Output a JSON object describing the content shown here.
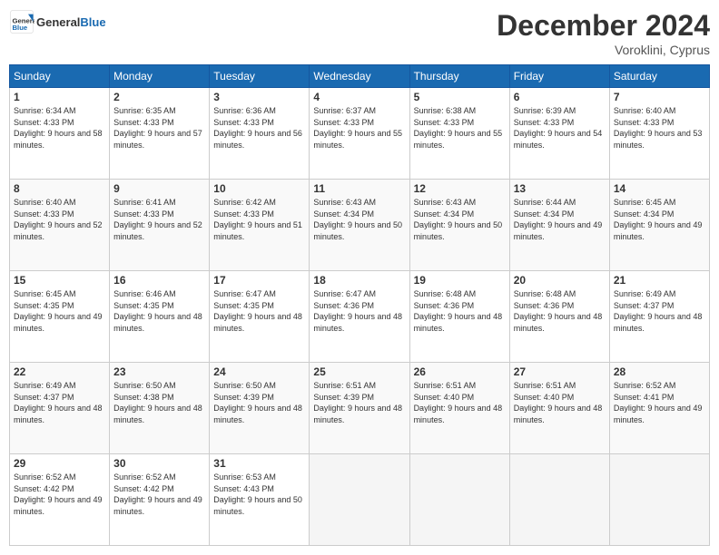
{
  "header": {
    "logo_general": "General",
    "logo_blue": "Blue",
    "month_title": "December 2024",
    "location": "Voroklini, Cyprus"
  },
  "weekdays": [
    "Sunday",
    "Monday",
    "Tuesday",
    "Wednesday",
    "Thursday",
    "Friday",
    "Saturday"
  ],
  "weeks": [
    [
      {
        "day": 1,
        "sunrise": "6:34 AM",
        "sunset": "4:33 PM",
        "daylight": "9 hours and 58 minutes."
      },
      {
        "day": 2,
        "sunrise": "6:35 AM",
        "sunset": "4:33 PM",
        "daylight": "9 hours and 57 minutes."
      },
      {
        "day": 3,
        "sunrise": "6:36 AM",
        "sunset": "4:33 PM",
        "daylight": "9 hours and 56 minutes."
      },
      {
        "day": 4,
        "sunrise": "6:37 AM",
        "sunset": "4:33 PM",
        "daylight": "9 hours and 55 minutes."
      },
      {
        "day": 5,
        "sunrise": "6:38 AM",
        "sunset": "4:33 PM",
        "daylight": "9 hours and 55 minutes."
      },
      {
        "day": 6,
        "sunrise": "6:39 AM",
        "sunset": "4:33 PM",
        "daylight": "9 hours and 54 minutes."
      },
      {
        "day": 7,
        "sunrise": "6:40 AM",
        "sunset": "4:33 PM",
        "daylight": "9 hours and 53 minutes."
      }
    ],
    [
      {
        "day": 8,
        "sunrise": "6:40 AM",
        "sunset": "4:33 PM",
        "daylight": "9 hours and 52 minutes."
      },
      {
        "day": 9,
        "sunrise": "6:41 AM",
        "sunset": "4:33 PM",
        "daylight": "9 hours and 52 minutes."
      },
      {
        "day": 10,
        "sunrise": "6:42 AM",
        "sunset": "4:33 PM",
        "daylight": "9 hours and 51 minutes."
      },
      {
        "day": 11,
        "sunrise": "6:43 AM",
        "sunset": "4:34 PM",
        "daylight": "9 hours and 50 minutes."
      },
      {
        "day": 12,
        "sunrise": "6:43 AM",
        "sunset": "4:34 PM",
        "daylight": "9 hours and 50 minutes."
      },
      {
        "day": 13,
        "sunrise": "6:44 AM",
        "sunset": "4:34 PM",
        "daylight": "9 hours and 49 minutes."
      },
      {
        "day": 14,
        "sunrise": "6:45 AM",
        "sunset": "4:34 PM",
        "daylight": "9 hours and 49 minutes."
      }
    ],
    [
      {
        "day": 15,
        "sunrise": "6:45 AM",
        "sunset": "4:35 PM",
        "daylight": "9 hours and 49 minutes."
      },
      {
        "day": 16,
        "sunrise": "6:46 AM",
        "sunset": "4:35 PM",
        "daylight": "9 hours and 48 minutes."
      },
      {
        "day": 17,
        "sunrise": "6:47 AM",
        "sunset": "4:35 PM",
        "daylight": "9 hours and 48 minutes."
      },
      {
        "day": 18,
        "sunrise": "6:47 AM",
        "sunset": "4:36 PM",
        "daylight": "9 hours and 48 minutes."
      },
      {
        "day": 19,
        "sunrise": "6:48 AM",
        "sunset": "4:36 PM",
        "daylight": "9 hours and 48 minutes."
      },
      {
        "day": 20,
        "sunrise": "6:48 AM",
        "sunset": "4:36 PM",
        "daylight": "9 hours and 48 minutes."
      },
      {
        "day": 21,
        "sunrise": "6:49 AM",
        "sunset": "4:37 PM",
        "daylight": "9 hours and 48 minutes."
      }
    ],
    [
      {
        "day": 22,
        "sunrise": "6:49 AM",
        "sunset": "4:37 PM",
        "daylight": "9 hours and 48 minutes."
      },
      {
        "day": 23,
        "sunrise": "6:50 AM",
        "sunset": "4:38 PM",
        "daylight": "9 hours and 48 minutes."
      },
      {
        "day": 24,
        "sunrise": "6:50 AM",
        "sunset": "4:39 PM",
        "daylight": "9 hours and 48 minutes."
      },
      {
        "day": 25,
        "sunrise": "6:51 AM",
        "sunset": "4:39 PM",
        "daylight": "9 hours and 48 minutes."
      },
      {
        "day": 26,
        "sunrise": "6:51 AM",
        "sunset": "4:40 PM",
        "daylight": "9 hours and 48 minutes."
      },
      {
        "day": 27,
        "sunrise": "6:51 AM",
        "sunset": "4:40 PM",
        "daylight": "9 hours and 48 minutes."
      },
      {
        "day": 28,
        "sunrise": "6:52 AM",
        "sunset": "4:41 PM",
        "daylight": "9 hours and 49 minutes."
      }
    ],
    [
      {
        "day": 29,
        "sunrise": "6:52 AM",
        "sunset": "4:42 PM",
        "daylight": "9 hours and 49 minutes."
      },
      {
        "day": 30,
        "sunrise": "6:52 AM",
        "sunset": "4:42 PM",
        "daylight": "9 hours and 49 minutes."
      },
      {
        "day": 31,
        "sunrise": "6:53 AM",
        "sunset": "4:43 PM",
        "daylight": "9 hours and 50 minutes."
      },
      null,
      null,
      null,
      null
    ]
  ]
}
